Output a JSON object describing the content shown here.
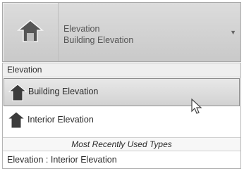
{
  "type_selector": {
    "family": "Elevation",
    "type": "Building Elevation",
    "icon": "elevation-house-icon",
    "dropdown_icon": "dropdown-arrow-icon"
  },
  "list": {
    "group_header": "Elevation",
    "items": [
      {
        "label": "Building Elevation",
        "icon": "elevation-house-icon",
        "selected": true
      },
      {
        "label": "Interior Elevation",
        "icon": "elevation-house-icon",
        "selected": false
      }
    ],
    "mru_header": "Most Recently Used Types",
    "mru_items": [
      {
        "label": "Elevation : Interior Elevation"
      }
    ]
  },
  "cursor": {
    "icon": "mouse-pointer-icon"
  }
}
